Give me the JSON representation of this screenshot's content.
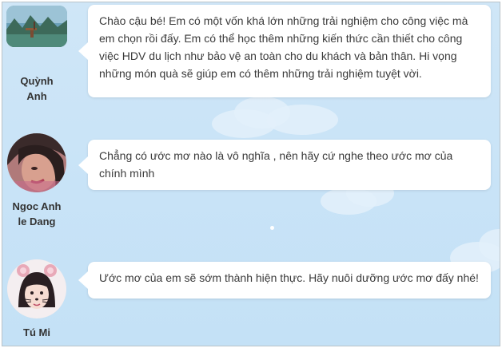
{
  "colors": {
    "background": "#c8e3f7",
    "bubble": "#ffffff",
    "text": "#3a3a3a",
    "name": "#333333"
  },
  "comments": [
    {
      "author": "Quỳnh Anh",
      "name_lines": [
        "Quỳnh",
        "Anh"
      ],
      "avatar": "landscape-photo-avatar",
      "text": "Chào cậu bé! Em có một vốn khá lớn những trải nghiệm cho công việc mà em chọn rồi đấy. Em có thể học thêm những kiến thức cần thiết cho công việc HDV du lịch như bảo vệ an toàn cho du khách và bản thân. Hi vọng những món quà sẽ giúp em có thêm những trải nghiệm tuyệt vời."
    },
    {
      "author": "Ngoc Anh le Dang",
      "name_lines": [
        "Ngoc Anh",
        "le Dang"
      ],
      "avatar": "woman-portrait-avatar",
      "text": "Chẳng có ước mơ nào là vô nghĩa , nên hãy cứ nghe theo ước mơ của chính mình"
    },
    {
      "author": "Tú Mi",
      "name_lines": [
        "Tú Mi"
      ],
      "avatar": "girl-cat-filter-avatar",
      "text": "Ước mơ của em sẽ sớm thành hiện thực. Hãy nuôi dưỡng ước mơ đấy nhé!"
    }
  ]
}
